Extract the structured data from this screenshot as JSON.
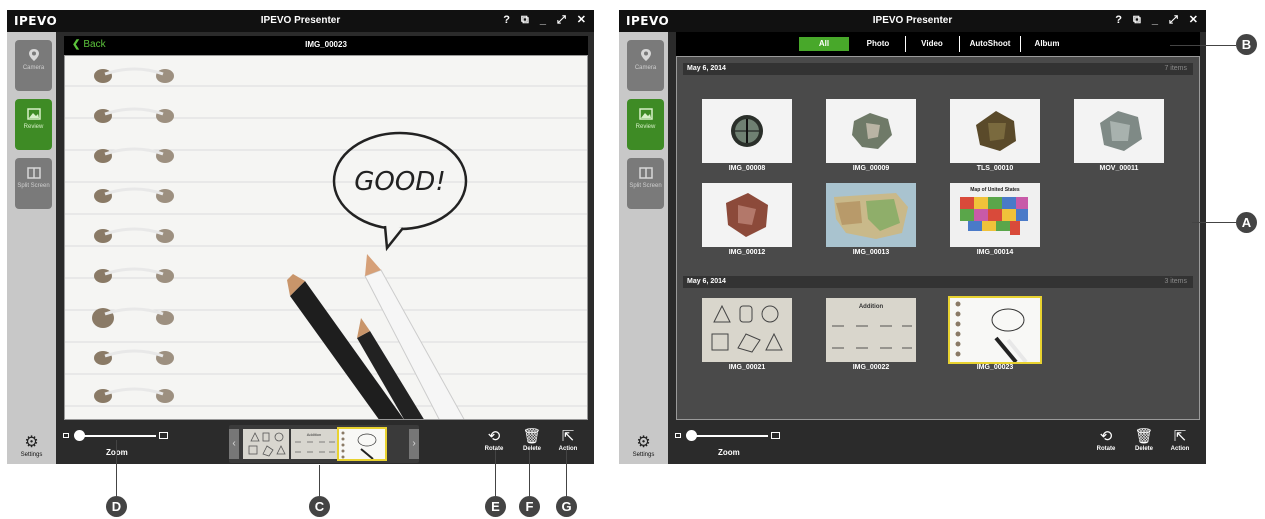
{
  "app": {
    "logo": "IPEVO",
    "title": "IPEVO Presenter"
  },
  "window_controls": {
    "help": "?",
    "restore": "⧉",
    "minimize": "_",
    "fullscreen": "⤢",
    "close": "✕"
  },
  "sidebar": {
    "camera": "Camera",
    "review": "Review",
    "split": "Split Screen",
    "settings": "Settings"
  },
  "left": {
    "back_label": "Back",
    "image_name": "IMG_00023",
    "drawing_text": "GOOD!",
    "zoom_label": "Zoom",
    "rotate": "Rotate",
    "delete": "Delete",
    "action": "Action",
    "strip_prev": "‹",
    "strip_next": "›",
    "strip_thumb_title": "Addition"
  },
  "right": {
    "filters": [
      "All",
      "Photo",
      "Video",
      "AutoShoot",
      "Album"
    ],
    "sections": [
      {
        "date": "May 6, 2014",
        "count": "7 items",
        "items": [
          "IMG_00008",
          "IMG_00009",
          "TLS_00010",
          "MOV_00011",
          "IMG_00012",
          "IMG_00013",
          "IMG_00014"
        ]
      },
      {
        "date": "May 6, 2014",
        "count": "3 items",
        "items": [
          "IMG_00021",
          "IMG_00022",
          "IMG_00023"
        ]
      }
    ],
    "map_title": "Map of United States",
    "addition_title": "Addition",
    "zoom_label": "Zoom",
    "rotate": "Rotate",
    "delete": "Delete",
    "action": "Action"
  },
  "callouts": [
    "A",
    "B",
    "C",
    "D",
    "E",
    "F",
    "G"
  ],
  "colors": {
    "accent": "#48a82a",
    "selection": "#e8d230",
    "callout": "#444444"
  }
}
